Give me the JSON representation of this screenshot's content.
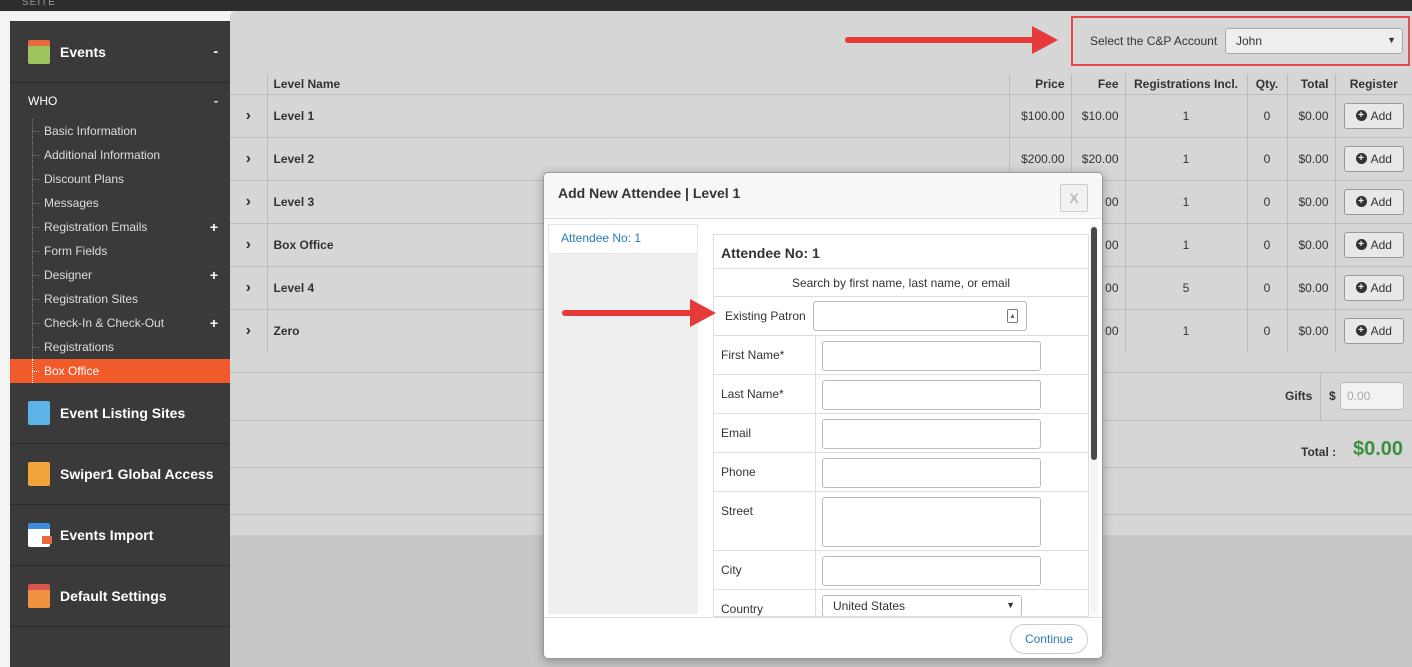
{
  "brand": "SEITE",
  "sidebar": {
    "events": {
      "label": "Events",
      "toggle": "-"
    },
    "who": {
      "label": "WHO",
      "toggle": "-"
    },
    "items": [
      {
        "label": "Basic Information",
        "plus": ""
      },
      {
        "label": "Additional Information",
        "plus": ""
      },
      {
        "label": "Discount Plans",
        "plus": ""
      },
      {
        "label": "Messages",
        "plus": ""
      },
      {
        "label": "Registration Emails",
        "plus": "+"
      },
      {
        "label": "Form Fields",
        "plus": ""
      },
      {
        "label": "Designer",
        "plus": "+"
      },
      {
        "label": "Registration Sites",
        "plus": ""
      },
      {
        "label": "Check-In & Check-Out",
        "plus": "+"
      },
      {
        "label": "Registrations",
        "plus": ""
      },
      {
        "label": "Box Office",
        "plus": ""
      }
    ],
    "sections": [
      {
        "label": "Event Listing Sites",
        "icon": "document-icon"
      },
      {
        "label": "Swiper1 Global Access",
        "icon": "phone-icon"
      },
      {
        "label": "Events Import",
        "icon": "import-icon"
      },
      {
        "label": "Default Settings",
        "icon": "settings-icon"
      }
    ]
  },
  "account": {
    "label": "Select the C&P Account",
    "value": "John"
  },
  "table": {
    "headers": {
      "level_name": "Level Name",
      "price": "Price",
      "fee": "Fee",
      "reg_incl": "Registrations Incl.",
      "qty": "Qty.",
      "total": "Total",
      "register": "Register"
    },
    "rows": [
      {
        "name": "Level 1",
        "price": "$100.00",
        "fee": "$10.00",
        "reg": "1",
        "qty": "0",
        "total": "$0.00",
        "btn": "Add"
      },
      {
        "name": "Level 2",
        "price": "$200.00",
        "fee": "$20.00",
        "reg": "1",
        "qty": "0",
        "total": "$0.00",
        "btn": "Add"
      },
      {
        "name": "Level 3",
        "price": "",
        "fee": "00",
        "reg": "1",
        "qty": "0",
        "total": "$0.00",
        "btn": "Add"
      },
      {
        "name": "Box Office",
        "price": "",
        "fee": "00",
        "reg": "1",
        "qty": "0",
        "total": "$0.00",
        "btn": "Add"
      },
      {
        "name": "Level 4",
        "price": "",
        "fee": "00",
        "reg": "5",
        "qty": "0",
        "total": "$0.00",
        "btn": "Add"
      },
      {
        "name": "Zero",
        "price": "",
        "fee": "00",
        "reg": "1",
        "qty": "0",
        "total": "$0.00",
        "btn": "Add"
      }
    ]
  },
  "gifts": {
    "label": "Gifts",
    "currency": "$",
    "placeholder": "0.00"
  },
  "total": {
    "label": "Total :",
    "value": "$0.00"
  },
  "modal": {
    "title": "Add New Attendee | Level 1",
    "close": "X",
    "tab": "Attendee No: 1",
    "attendee_title": "Attendee No: 1",
    "search_hint": "Search by first name, last name, or email",
    "existing_patron": "Existing Patron",
    "fields": {
      "first_name": "First Name*",
      "last_name": "Last Name*",
      "email": "Email",
      "phone": "Phone",
      "street": "Street",
      "city": "City",
      "country": "Country"
    },
    "country_value": "United States",
    "continue": "Continue"
  },
  "colors": {
    "active_item": "#f15a29",
    "arrow": "#e63a3a",
    "total_green": "#3d8f3d",
    "link_blue": "#2a7ab8"
  }
}
